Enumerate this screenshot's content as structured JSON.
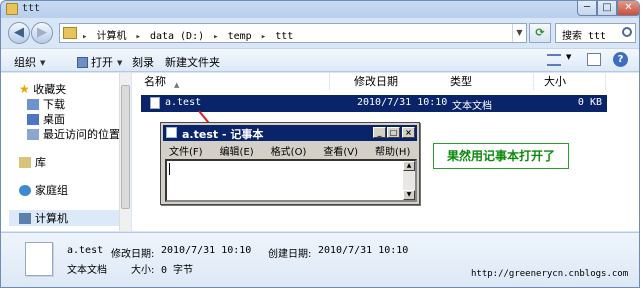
{
  "window": {
    "title": "ttt",
    "min_glyph": "─",
    "max_glyph": "□",
    "close_glyph": "✕"
  },
  "address": {
    "crumbs": [
      "计算机",
      "data (D:)",
      "temp",
      "ttt"
    ],
    "separator": "▸",
    "back_glyph": "◀",
    "forward_glyph": "▶"
  },
  "search": {
    "placeholder": "搜索 ttt"
  },
  "toolbar": {
    "organize": "组织",
    "open": "打开",
    "burn": "刻录",
    "new_folder": "新建文件夹"
  },
  "nav": {
    "favorites": "收藏夹",
    "downloads": "下载",
    "desktop": "桌面",
    "recent": "最近访问的位置",
    "libraries": "库",
    "homegroup": "家庭组",
    "computer": "计算机"
  },
  "columns": {
    "name": "名称",
    "modified": "修改日期",
    "type": "类型",
    "size": "大小"
  },
  "files": [
    {
      "name": "a.test",
      "modified": "2010/7/31 10:10",
      "type": "文本文档",
      "size": "0 KB"
    }
  ],
  "notepad": {
    "title": "a.test - 记事本",
    "menu": [
      "文件(F)",
      "编辑(E)",
      "格式(O)",
      "查看(V)",
      "帮助(H)"
    ],
    "min_glyph": "_",
    "max_glyph": "□",
    "close_glyph": "×"
  },
  "callout": "果然用记事本打开了",
  "details": {
    "name": "a.test",
    "modified_label": "修改日期:",
    "modified": "2010/7/31 10:10",
    "created_label": "创建日期:",
    "created": "2010/7/31 10:10",
    "type": "文本文档",
    "size_label": "大小:",
    "size": "0 字节"
  },
  "watermark": "http://greenerycn.cnblogs.com",
  "colors": {
    "selection": "#0a246a",
    "callout": "#0c8a0c",
    "arrow": "#d91e1e"
  }
}
